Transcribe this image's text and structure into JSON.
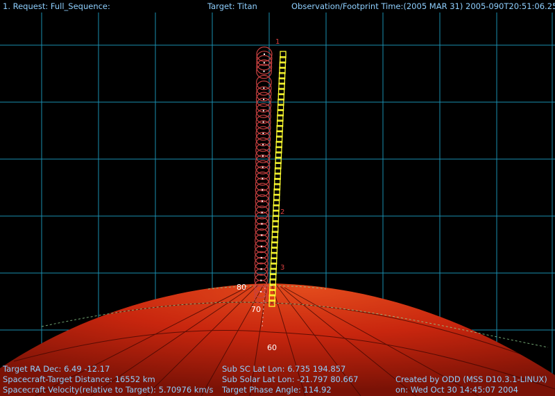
{
  "header": {
    "request": "1. Request: Full_Sequence:",
    "target": "Target: Titan",
    "obs_time": "Observation/Footprint Time:(2005 MAR 31) 2005-090T20:51:06.25"
  },
  "sequence_markers": [
    "1",
    "2",
    "3"
  ],
  "latitude_labels": [
    "80",
    "70",
    "60"
  ],
  "footer": {
    "left": [
      "Target RA Dec:  6.49  -12.17",
      "Spacecraft-Target Distance:    16552 km",
      "Spacecraft Velocity(relative to Target): 5.70976 km/s"
    ],
    "middle": [
      "Sub SC Lat Lon:  6.735  194.857",
      "Sub Solar Lat Lon:  -21.797  80.667",
      "Target Phase Angle: 114.92"
    ],
    "right": [
      "Created by ODD (MSS D10.3.1-LINUX)",
      "on: Wed Oct 30 14:45:07 2004"
    ]
  },
  "colors": {
    "background": "#000000",
    "grid": "#1fa8d0",
    "planet": "#c8260e",
    "planet_dark": "#6e1006",
    "footprint_red": "#c64040",
    "footprint_yellow": "#ffff30",
    "hud_text": "#8fd0ff"
  }
}
